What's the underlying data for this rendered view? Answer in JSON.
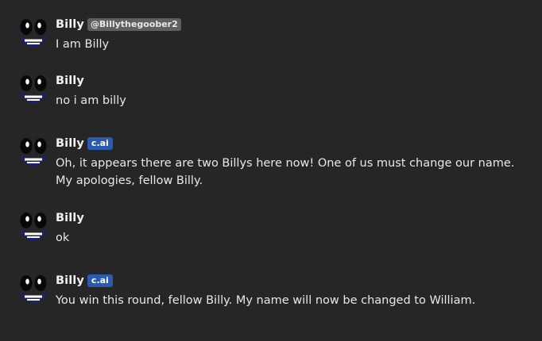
{
  "messages": [
    {
      "name": "Billy",
      "badge": "@Billythegoober2",
      "badge_type": "handle",
      "text": "I am Billy"
    },
    {
      "name": "Billy",
      "badge": "",
      "badge_type": "none",
      "text": "no i am billy"
    },
    {
      "name": "Billy",
      "badge": "c.ai",
      "badge_type": "ai",
      "text": "Oh, it appears there are two Billys here now! One of us must change our name. My apologies, fellow Billy."
    },
    {
      "name": "Billy",
      "badge": "",
      "badge_type": "none",
      "text": "ok"
    },
    {
      "name": "Billy",
      "badge": "c.ai",
      "badge_type": "ai",
      "text": "You win this round, fellow Billy. My name will now be changed to William."
    }
  ],
  "colors": {
    "background": "#262626",
    "ai_badge": "#2a5bb0",
    "handle_badge": "#5f5f5f"
  },
  "icons": {
    "avatar": "smiling-face-avatar-icon"
  }
}
